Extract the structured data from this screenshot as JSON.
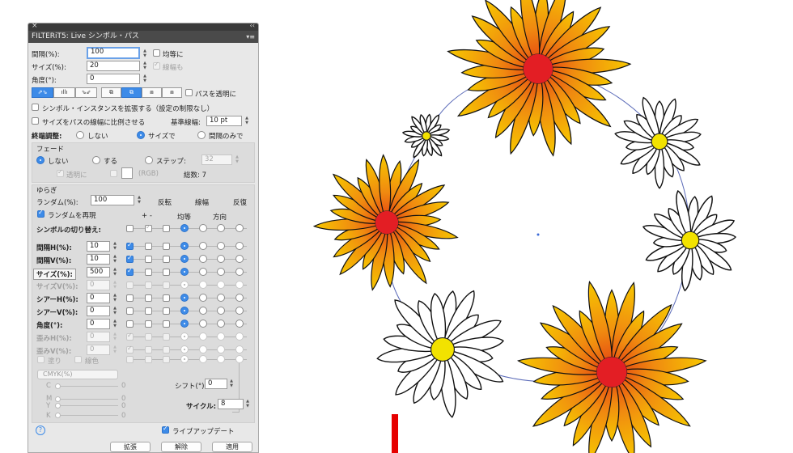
{
  "panel": {
    "close_icon": "×",
    "collapse_icon": "‹‹",
    "title": "FILTERiT5: Live シンボル・パス",
    "menu_icon": "▾≡",
    "spacing_label": "間隔(%):",
    "spacing_value": "100",
    "equalize_label": "均等に",
    "size_label": "サイズ(%):",
    "size_value": "20",
    "stroke_label": "線幅も",
    "angle_label": "角度(°):",
    "angle_value": "0",
    "path_transparent_label": "パスを透明に",
    "expand_instances_label": "シンボル・インスタンスを拡張する（設定の制限なし）",
    "scale_by_stroke_label": "サイズをパスの線幅に比例させる",
    "base_stroke_label": "基準線幅:",
    "base_stroke_value": "10 pt",
    "end_adjust_label": "終端調整:",
    "end_none": "しない",
    "end_size": "サイズで",
    "end_spacing": "間隔のみで",
    "fade": {
      "title": "フェード",
      "off": "しない",
      "on": "する",
      "step": "ステップ:",
      "step_value": "32",
      "transparent": "透明に",
      "rgb": "(RGB)",
      "total": "総数: 7"
    },
    "jitter": {
      "title": "ゆらぎ",
      "random_label": "ランダム(%):",
      "random_value": "100",
      "invert": "反転",
      "stroke": "線幅",
      "repeat": "反復",
      "reproduce": "ランダムを再現",
      "plusminus": "+ -",
      "uniform": "均等",
      "direction": "方向",
      "symbol_switch": "シンボルの切り替え:",
      "rows": [
        {
          "label": "間隔H(%):",
          "value": "10"
        },
        {
          "label": "間隔V(%):",
          "value": "10"
        },
        {
          "label": "サイズ(%):",
          "value": "500"
        },
        {
          "label": "サイズV(%):",
          "value": "0"
        },
        {
          "label": "シアーH(%):",
          "value": "0"
        },
        {
          "label": "シアーV(%):",
          "value": "0"
        },
        {
          "label": "角度(°):",
          "value": "0"
        },
        {
          "label": "歪みH(%):",
          "value": "0"
        },
        {
          "label": "歪みV(%):",
          "value": "0"
        }
      ],
      "fill": "塗り",
      "line_color": "線色",
      "color_mode": "CMYK(%)",
      "shift_label": "シフト(°):",
      "shift_value": "0",
      "cycle_label": "サイクル:",
      "cycle_value": "8",
      "cmyk": [
        {
          "label": "C",
          "value": "0"
        },
        {
          "label": "M",
          "value": "0"
        },
        {
          "label": "Y",
          "value": "0"
        },
        {
          "label": "K",
          "value": "0"
        }
      ]
    },
    "help_icon": "?",
    "live_update": "ライブアップデート",
    "expand_button": "拡張",
    "release_button": "解除",
    "apply_button": "適用"
  },
  "canvas": {
    "orange_flower_colors": [
      "#f6a800",
      "#ee6a00",
      "#e31e24"
    ],
    "white_flower_center": "#f2e200",
    "path_color": "#5a6ab8"
  }
}
